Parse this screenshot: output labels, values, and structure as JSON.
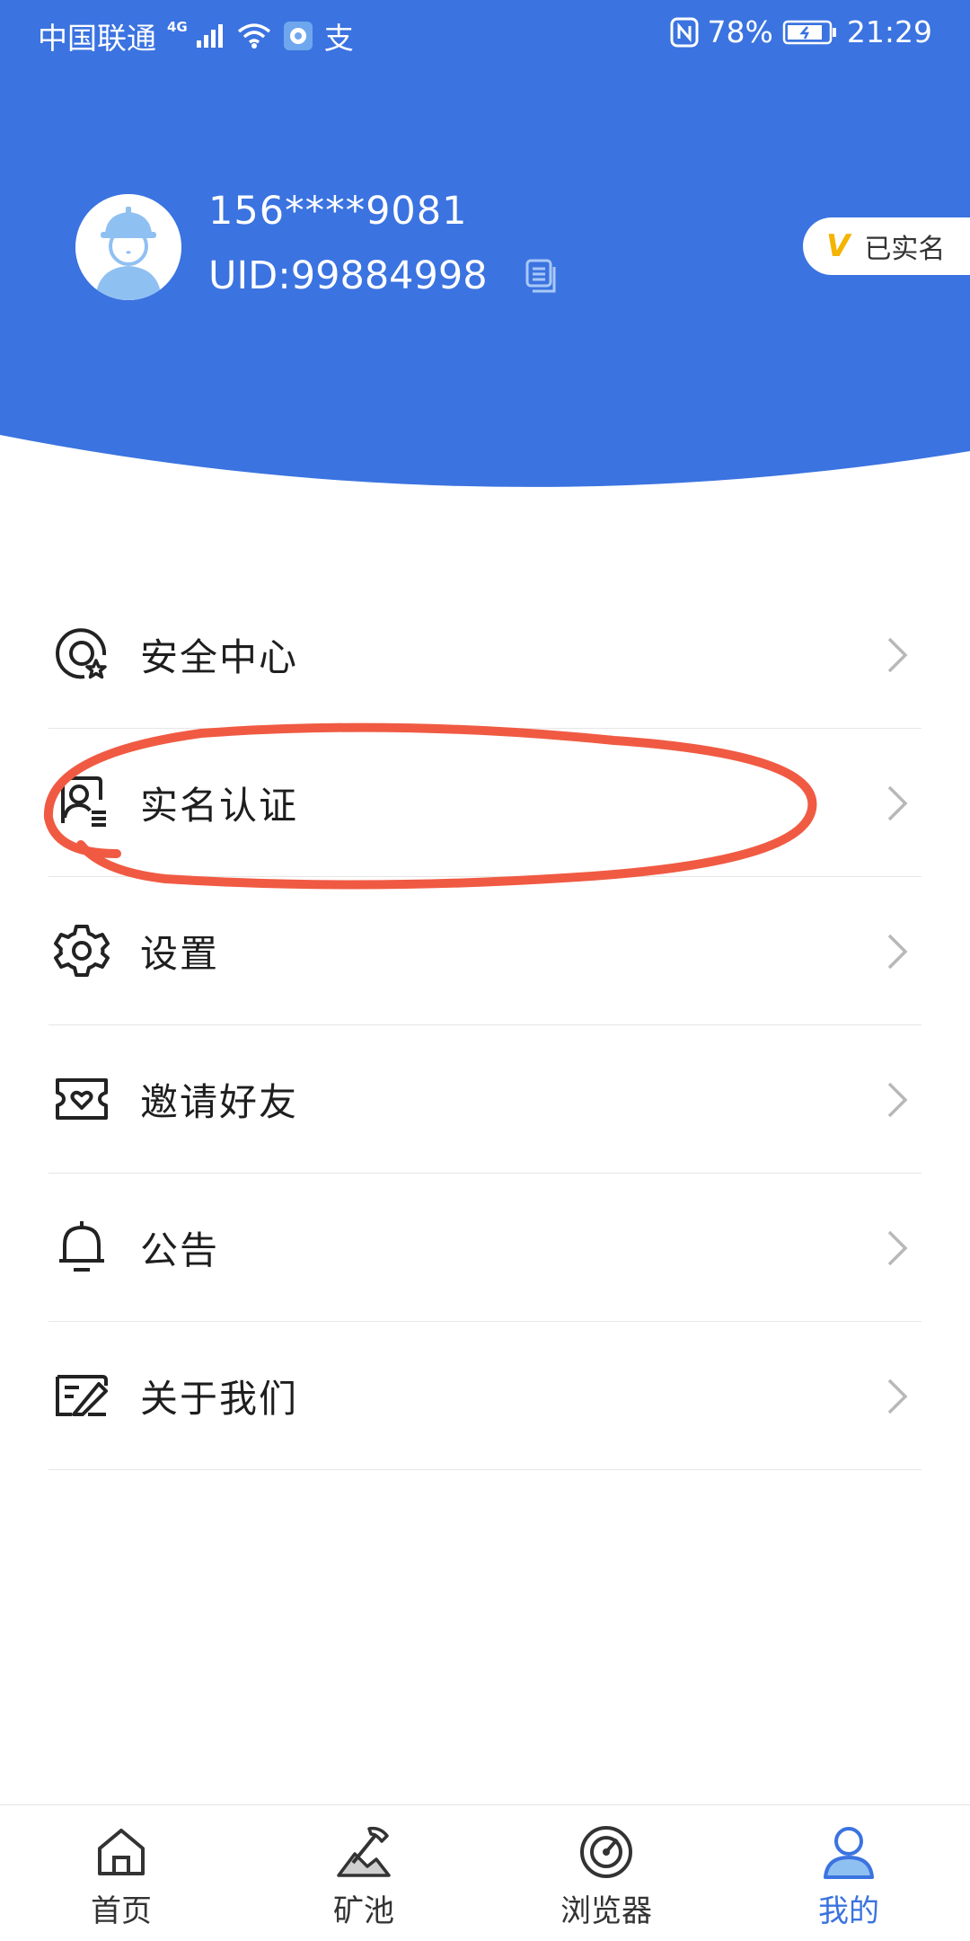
{
  "status_bar": {
    "carrier": "中国联通",
    "network": "4G",
    "alipay_glyph": "支",
    "battery": "78%",
    "time": "21:29",
    "icons": [
      "signal-icon",
      "wifi-icon",
      "app-notification-icon",
      "nfc-icon",
      "battery-icon"
    ]
  },
  "profile": {
    "phone": "156****9081",
    "uid": "UID:99884998",
    "verified_mark": "V",
    "verified_label": "已实名"
  },
  "menu": {
    "items": [
      {
        "label": "安全中心",
        "icon": "security-center-icon"
      },
      {
        "label": "实名认证",
        "icon": "id-verification-icon"
      },
      {
        "label": "设置",
        "icon": "gear-icon"
      },
      {
        "label": "邀请好友",
        "icon": "invite-ticket-icon"
      },
      {
        "label": "公告",
        "icon": "bell-icon"
      },
      {
        "label": "关于我们",
        "icon": "about-icon"
      }
    ]
  },
  "bottom_nav": {
    "items": [
      {
        "label": "首页",
        "icon": "home-icon"
      },
      {
        "label": "矿池",
        "icon": "mining-pool-icon"
      },
      {
        "label": "浏览器",
        "icon": "browser-icon"
      },
      {
        "label": "我的",
        "icon": "profile-icon",
        "active": true
      }
    ]
  },
  "colors": {
    "header_blue": "#3b73e0",
    "annotation_red": "#f05a43",
    "active_tab": "#3b73e0",
    "badge_gold": "#f4b400"
  }
}
